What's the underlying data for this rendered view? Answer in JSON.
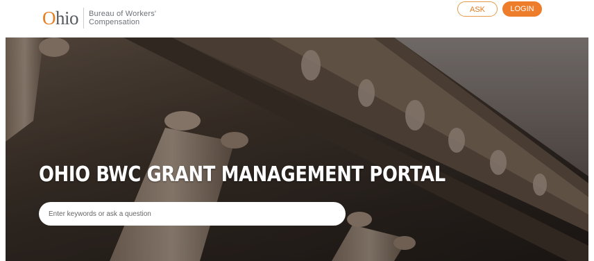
{
  "header": {
    "logo_word": "hio",
    "logo_initial": "O",
    "logo_line1": "Bureau of Workers'",
    "logo_line2": "Compensation",
    "ask_label": "ASK",
    "login_label": "LOGIN"
  },
  "hero": {
    "title": "OHIO BWC GRANT MANAGEMENT PORTAL",
    "search_placeholder": "Enter keywords or ask a question"
  },
  "colors": {
    "accent": "#ee7d2b",
    "logo_gray": "#555a60"
  },
  "icons": {
    "hero_background": "building-columns-image"
  }
}
